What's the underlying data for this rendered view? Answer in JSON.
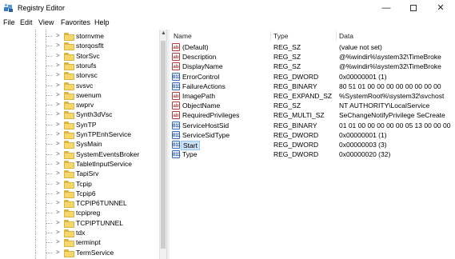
{
  "window": {
    "title": "Registry Editor",
    "controls": {
      "minimize": "—",
      "close": "✕"
    }
  },
  "menu": [
    "File",
    "Edit",
    "View",
    "Favorites",
    "Help"
  ],
  "tree": {
    "items": [
      "stornvme",
      "storqosflt",
      "StorSvc",
      "storufs",
      "storvsc",
      "svsvc",
      "swenum",
      "swprv",
      "Synth3dVsc",
      "SynTP",
      "SynTPEnhService",
      "SysMain",
      "SystemEventsBroker",
      "TabletInputService",
      "TapiSrv",
      "Tcpip",
      "Tcpip6",
      "TCPIP6TUNNEL",
      "tcpipreg",
      "TCPIPTUNNEL",
      "tdx",
      "terminpt",
      "TermService"
    ]
  },
  "list": {
    "headers": {
      "name": "Name",
      "type": "Type",
      "data": "Data"
    },
    "rows": [
      {
        "icon": "ab",
        "name": "(Default)",
        "type": "REG_SZ",
        "data": "(value not set)"
      },
      {
        "icon": "ab",
        "name": "Description",
        "type": "REG_SZ",
        "data": "@%windir%\\system32\\TimeBroke"
      },
      {
        "icon": "ab",
        "name": "DisplayName",
        "type": "REG_SZ",
        "data": "@%windir%\\system32\\TimeBroke"
      },
      {
        "icon": "bin",
        "name": "ErrorControl",
        "type": "REG_DWORD",
        "data": "0x00000001 (1)"
      },
      {
        "icon": "bin",
        "name": "FailureActions",
        "type": "REG_BINARY",
        "data": "80 51 01 00 00 00 00 00 00 00 00"
      },
      {
        "icon": "ab",
        "name": "ImagePath",
        "type": "REG_EXPAND_SZ",
        "data": "%SystemRoot%\\system32\\svchost"
      },
      {
        "icon": "ab",
        "name": "ObjectName",
        "type": "REG_SZ",
        "data": "NT AUTHORITY\\LocalService"
      },
      {
        "icon": "ab",
        "name": "RequiredPrivileges",
        "type": "REG_MULTI_SZ",
        "data": "SeChangeNotifyPrivilege SeCreate"
      },
      {
        "icon": "bin",
        "name": "ServiceHostSid",
        "type": "REG_BINARY",
        "data": "01 01 00 00 00 00 00 05 13 00 00 00"
      },
      {
        "icon": "bin",
        "name": "ServiceSidType",
        "type": "REG_DWORD",
        "data": "0x00000001 (1)"
      },
      {
        "icon": "bin",
        "name": "Start",
        "type": "REG_DWORD",
        "data": "0x00000003 (3)",
        "selected": true
      },
      {
        "icon": "bin",
        "name": "Type",
        "type": "REG_DWORD",
        "data": "0x00000020 (32)"
      }
    ]
  },
  "icon_labels": {
    "ab": "ab",
    "bin": "011"
  },
  "colors": {
    "selection_bg": "#cde3f9",
    "folder": "#f5d76a",
    "string_icon": "#b23a3a",
    "binary_icon": "#3c6fbf"
  }
}
